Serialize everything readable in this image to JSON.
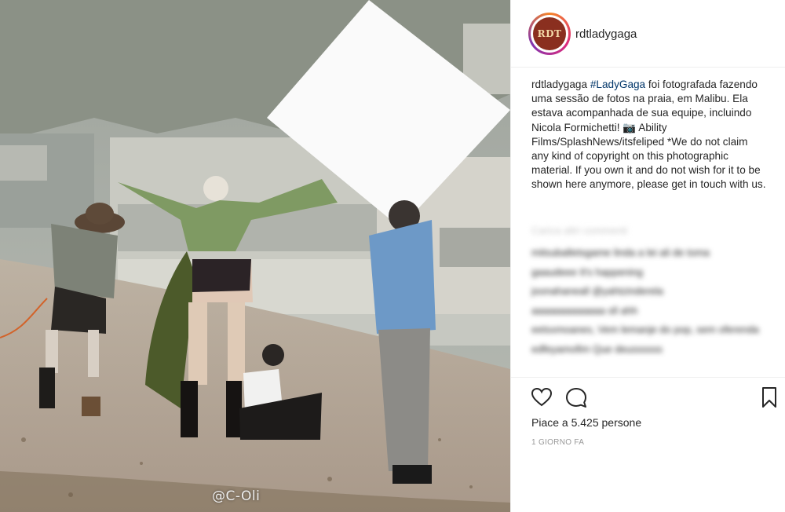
{
  "photo": {
    "watermark": "@C-Oli"
  },
  "post": {
    "avatar_text": "RDT",
    "username": "rdtladygaga",
    "caption_user": "rdtladygaga",
    "caption_hashtag": "#LadyGaga",
    "caption_text": "foi fotografada fazendo uma sessão de fotos na praia, em Malibu. Ela estava acompanhada de sua equipe, incluindo Nicola Formichetti! 📷 Ability Films/SplashNews/itsfeliped *We do not claim any kind of copyright on this photographic material. If you own it and do not wish for it to be shown here anymore, please get in touch with us.",
    "load_more": "Carica altri commenti",
    "comments": [
      "mitsuballetsgame linda a lei ali de toma",
      "gaaudeee It's happening",
      "joonahaneall @yahtzinderela",
      "aaaaaaaaaaaaa sll ahh",
      "eetsxmoanes, Vem lemanje do pop, sem oferenda",
      "edfeyamofim Que deussssss"
    ],
    "likes": "Piace a 5.425 persone",
    "timestamp": "1 GIORNO FA",
    "icons": [
      "heart-icon",
      "comment-icon",
      "bookmark-icon"
    ]
  }
}
